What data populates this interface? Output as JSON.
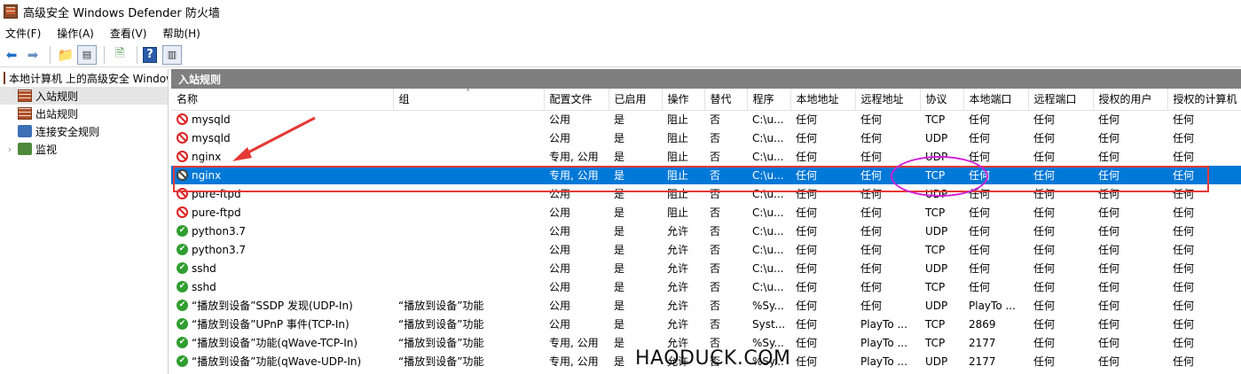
{
  "window": {
    "title": "高级安全 Windows Defender 防火墙"
  },
  "menu": [
    "文件(F)",
    "操作(A)",
    "查看(V)",
    "帮助(H)"
  ],
  "tree": {
    "root": "本地计算机 上的高级安全 Windows Defender 防火墙",
    "items": [
      "入站规则",
      "出站规则",
      "连接安全规则",
      "监视"
    ]
  },
  "panel": {
    "title": "入站规则"
  },
  "columns": [
    "名称",
    "组",
    "配置文件",
    "已启用",
    "操作",
    "替代",
    "程序",
    "本地地址",
    "远程地址",
    "协议",
    "本地端口",
    "远程端口",
    "授权的用户",
    "授权的计算机"
  ],
  "rows": [
    {
      "icon": "block",
      "cells": [
        "mysqld",
        "",
        "公用",
        "是",
        "阻止",
        "否",
        "C:\\u...",
        "任何",
        "任何",
        "TCP",
        "任何",
        "任何",
        "任何",
        "任何"
      ]
    },
    {
      "icon": "block",
      "cells": [
        "mysqld",
        "",
        "公用",
        "是",
        "阻止",
        "否",
        "C:\\u...",
        "任何",
        "任何",
        "UDP",
        "任何",
        "任何",
        "任何",
        "任何"
      ]
    },
    {
      "icon": "block",
      "cells": [
        "nginx",
        "",
        "专用, 公用",
        "是",
        "阻止",
        "否",
        "C:\\u...",
        "任何",
        "任何",
        "UDP",
        "任何",
        "任何",
        "任何",
        "任何"
      ]
    },
    {
      "icon": "block",
      "selected": true,
      "cells": [
        "nginx",
        "",
        "专用, 公用",
        "是",
        "阻止",
        "否",
        "C:\\u...",
        "任何",
        "任何",
        "TCP",
        "任何",
        "任何",
        "任何",
        "任何"
      ]
    },
    {
      "icon": "block",
      "cells": [
        "pure-ftpd",
        "",
        "公用",
        "是",
        "阻止",
        "否",
        "C:\\u...",
        "任何",
        "任何",
        "UDP",
        "任何",
        "任何",
        "任何",
        "任何"
      ]
    },
    {
      "icon": "block",
      "cells": [
        "pure-ftpd",
        "",
        "公用",
        "是",
        "阻止",
        "否",
        "C:\\u...",
        "任何",
        "任何",
        "TCP",
        "任何",
        "任何",
        "任何",
        "任何"
      ]
    },
    {
      "icon": "allow",
      "cells": [
        "python3.7",
        "",
        "公用",
        "是",
        "允许",
        "否",
        "C:\\u...",
        "任何",
        "任何",
        "UDP",
        "任何",
        "任何",
        "任何",
        "任何"
      ]
    },
    {
      "icon": "allow",
      "cells": [
        "python3.7",
        "",
        "公用",
        "是",
        "允许",
        "否",
        "C:\\u...",
        "任何",
        "任何",
        "TCP",
        "任何",
        "任何",
        "任何",
        "任何"
      ]
    },
    {
      "icon": "allow",
      "cells": [
        "sshd",
        "",
        "公用",
        "是",
        "允许",
        "否",
        "C:\\u...",
        "任何",
        "任何",
        "UDP",
        "任何",
        "任何",
        "任何",
        "任何"
      ]
    },
    {
      "icon": "allow",
      "cells": [
        "sshd",
        "",
        "公用",
        "是",
        "允许",
        "否",
        "C:\\u...",
        "任何",
        "任何",
        "TCP",
        "任何",
        "任何",
        "任何",
        "任何"
      ]
    },
    {
      "icon": "allow",
      "cells": [
        "“播放到设备”SSDP 发现(UDP-In)",
        "“播放到设备”功能",
        "公用",
        "是",
        "允许",
        "否",
        "%Sy...",
        "任何",
        "任何",
        "UDP",
        "PlayTo ...",
        "任何",
        "任何",
        "任何"
      ]
    },
    {
      "icon": "allow",
      "cells": [
        "“播放到设备”UPnP 事件(TCP-In)",
        "“播放到设备”功能",
        "公用",
        "是",
        "允许",
        "否",
        "Syst...",
        "任何",
        "PlayTo ...",
        "TCP",
        "2869",
        "任何",
        "任何",
        "任何"
      ]
    },
    {
      "icon": "allow",
      "cells": [
        "“播放到设备”功能(qWave-TCP-In)",
        "“播放到设备”功能",
        "专用, 公用",
        "是",
        "允许",
        "否",
        "%Sy...",
        "任何",
        "PlayTo ...",
        "TCP",
        "2177",
        "任何",
        "任何",
        "任何"
      ]
    },
    {
      "icon": "allow",
      "cells": [
        "“播放到设备”功能(qWave-UDP-In)",
        "“播放到设备”功能",
        "专用, 公用",
        "是",
        "允许",
        "否",
        "%Sy...",
        "任何",
        "PlayTo ...",
        "UDP",
        "2177",
        "任何",
        "任何",
        "任何"
      ]
    }
  ],
  "watermark": "HAODUCK.COM",
  "colors": {
    "selection": "#0078d7",
    "highlight_box": "#e53935",
    "highlight_ellipse": "#d020d8"
  }
}
